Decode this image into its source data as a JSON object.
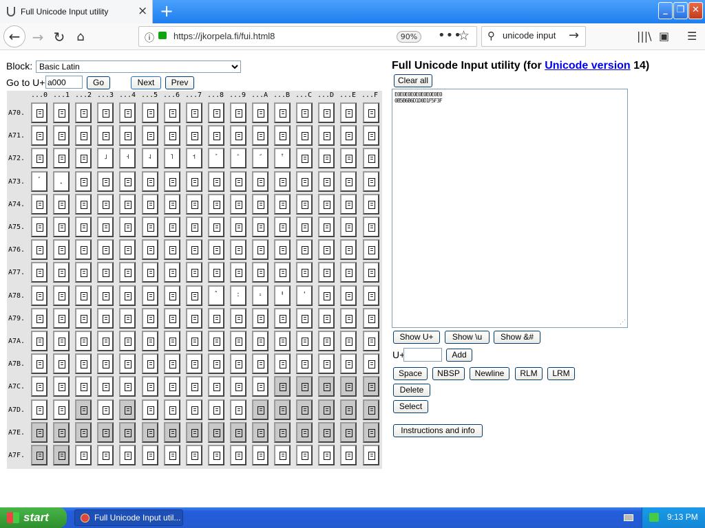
{
  "browser": {
    "tab_title": "Full Unicode Input utility",
    "tab_close": "×",
    "new_tab": "+",
    "url": "https://jkorpela.fi/fui.html8",
    "zoom": "90%",
    "search_value": "unicode input",
    "icons": [
      "back-icon",
      "forward-icon",
      "reload-icon",
      "home-icon",
      "lock-icon",
      "page-actions-icon",
      "bookmark-star-icon",
      "search-icon",
      "library-icon",
      "sidebar-icon",
      "menu-icon"
    ]
  },
  "form": {
    "block_label": "Block:",
    "block_value": "Basic Latin",
    "goto_label": "Go to U+",
    "goto_value": "a000",
    "go_button": "Go",
    "next_button": "Next",
    "prev_button": "Prev"
  },
  "grid": {
    "col_headers": [
      "...0",
      "...1",
      "...2",
      "...3",
      "...4",
      "...5",
      "...6",
      "...7",
      "...8",
      "...9",
      "...A",
      "...B",
      "...C",
      "...D",
      "...E",
      "...F"
    ],
    "row_headers": [
      "A70.",
      "A71.",
      "A72.",
      "A73.",
      "A74.",
      "A75.",
      "A76.",
      "A77.",
      "A78.",
      "A79.",
      "A7A.",
      "A7B.",
      "A7C.",
      "A7D.",
      "A7E.",
      "A7F."
    ],
    "symbols": {
      "23": "˩",
      "24": "˧",
      "25": "˨",
      "26": "˥",
      "27": "˦",
      "28": "ꜘ",
      "29": "ꜙ",
      "2a": "ꜚ",
      "2b": "ꜛ",
      "30": "˹",
      "31": "˻",
      "88": "ˆ",
      "89": "꞉",
      "8a": "꞊",
      "8b": "Ꞌ",
      "8c": "ꞌ"
    },
    "gray_cells": [
      "cb",
      "cc",
      "cd",
      "ce",
      "cf",
      "d2",
      "d4",
      "da",
      "db",
      "dc",
      "dd",
      "de",
      "df",
      "e0",
      "e1",
      "e2",
      "e3",
      "e4",
      "e5",
      "e6",
      "e7",
      "e8",
      "e9",
      "ea",
      "eb",
      "ec",
      "ed",
      "ee",
      "ef",
      "f0",
      "f1"
    ]
  },
  "main": {
    "heading_prefix": "Full Unicode Input utility (for ",
    "heading_link": "Unicode version",
    "heading_suffix": " 14)",
    "clear_all": "Clear all",
    "textarea_content": "E0E0E0E0E0E0E0E0E0\n0B5B6B6D1D0D1F5F3F",
    "show_uplus": "Show U+",
    "show_u": "Show \\u",
    "show_amp": "Show &#",
    "uplus_label": "U+",
    "add": "Add",
    "space": "Space",
    "nbsp": "NBSP",
    "newline": "Newline",
    "rlm": "RLM",
    "lrm": "LRM",
    "delete": "Delete",
    "select": "Select",
    "instructions": "Instructions and info"
  },
  "taskbar": {
    "start": "start",
    "task_item": "Full Unicode Input util...",
    "clock": "9:13 PM"
  }
}
